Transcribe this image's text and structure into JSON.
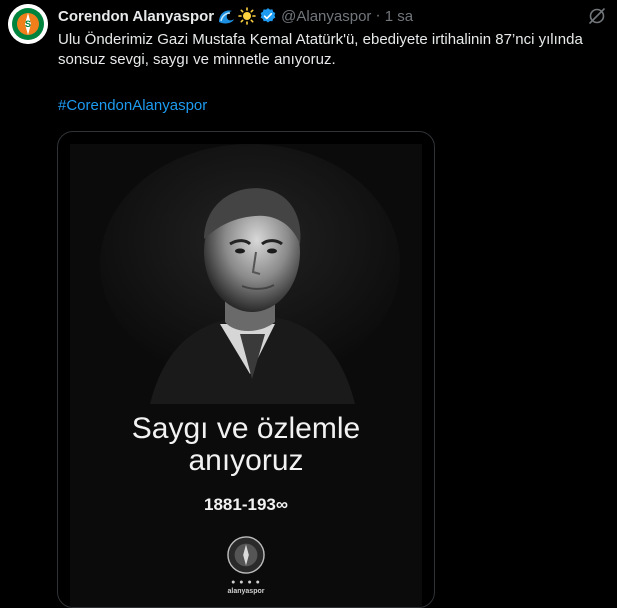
{
  "tweet": {
    "author_name": "Corendon Alanyaspor",
    "author_emojis": [
      "wave-icon",
      "sun-icon"
    ],
    "verified": true,
    "handle": "@Alanyaspor",
    "separator": "·",
    "time": "1 sa",
    "text": "Ulu Önderimiz Gazi Mustafa Kemal Atatürk'ü, ebediyete irtihalinin 87’nci yılında sonsuz sevgi, saygı ve minnetle anıyoruz.",
    "hashtag": "#CorendonAlanyaspor"
  },
  "poster": {
    "line1": "Saygı ve özlemle",
    "line2": "anıyoruz",
    "years": "1881-193∞",
    "brand": "alanyaspor"
  },
  "colors": {
    "background": "#000000",
    "text": "#e7e9ea",
    "muted": "#71767b",
    "link": "#1d9bf0",
    "verified": "#1d9bf0",
    "club_orange": "#f07e1b",
    "club_green": "#00843d"
  }
}
